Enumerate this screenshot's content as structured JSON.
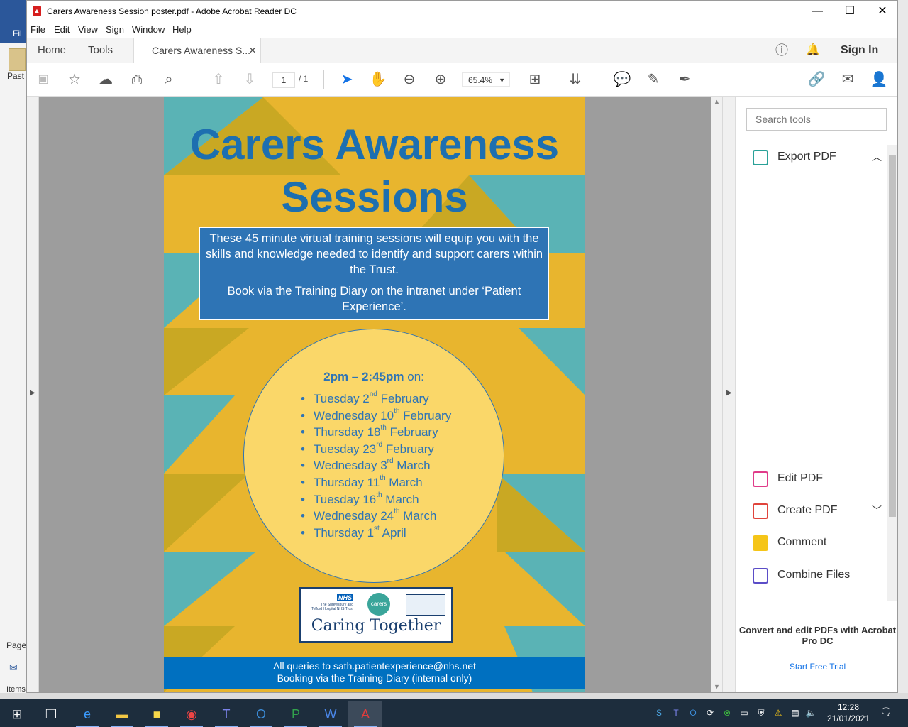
{
  "window": {
    "title": "Carers Awareness Session poster.pdf - Adobe Acrobat Reader DC",
    "controls": {
      "minimize": "—",
      "maximize": "☐",
      "close": "✕"
    }
  },
  "background_app": {
    "menu_label": "Fil",
    "paste_label": "Past",
    "page_label": "Page",
    "items_label": "Items"
  },
  "menu": [
    "File",
    "Edit",
    "View",
    "Sign",
    "Window",
    "Help"
  ],
  "tabs": {
    "home": "Home",
    "tools": "Tools",
    "document": "Carers Awareness S...",
    "close": "✕",
    "sign_in": "Sign In"
  },
  "toolbar": {
    "page_current": "1",
    "page_total": "/ 1",
    "zoom": "65.4%"
  },
  "poster": {
    "title_line1": "Carers Awareness",
    "title_line2": "Sessions",
    "intro": "These 45 minute virtual training sessions will equip you with the skills and knowledge needed to identify and support carers within the Trust.",
    "booking": "Book via the Training Diary on the intranet under ‘Patient Experience’.",
    "time_bold": "2pm – 2:45pm",
    "time_suffix": " on:",
    "sessions": [
      {
        "day": "Tuesday 2",
        "suffix": "nd",
        "month": " February"
      },
      {
        "day": "Wednesday 10",
        "suffix": "th",
        "month": " February"
      },
      {
        "day": "Thursday 18",
        "suffix": "th",
        "month": " February"
      },
      {
        "day": "Tuesday 23",
        "suffix": "rd",
        "month": " February"
      },
      {
        "day": "Wednesday 3",
        "suffix": "rd",
        "month": " March"
      },
      {
        "day": "Thursday 11",
        "suffix": "th",
        "month": " March"
      },
      {
        "day": "Tuesday 16",
        "suffix": "th",
        "month": " March"
      },
      {
        "day": "Wednesday 24",
        "suffix": "th",
        "month": " March"
      },
      {
        "day": "Thursday 1",
        "suffix": "st",
        "month": " April"
      }
    ],
    "logo": {
      "nhs": "NHS",
      "trust": "The Shrewsbury and Telford Hospital NHS Trust",
      "carers": "carers",
      "caring_together": "Caring Together"
    },
    "footer_line1": "All queries to sath.patientexperience@nhs.net",
    "footer_line2": "Booking via the Training Diary (internal only)",
    "colors": {
      "background": "#e8b52e",
      "title": "#1d6fb0",
      "box": "#2e74b5",
      "circle": "#fad769",
      "footer": "#0070c0"
    }
  },
  "tools_pane": {
    "search_placeholder": "Search tools",
    "export_pdf": "Export PDF",
    "edit_pdf": "Edit PDF",
    "create_pdf": "Create PDF",
    "comment": "Comment",
    "combine_files": "Combine Files",
    "promo": "Convert and edit PDFs with Acrobat Pro DC",
    "trial": "Start Free Trial"
  },
  "taskbar": {
    "time": "12:28",
    "date": "21/01/2021"
  }
}
